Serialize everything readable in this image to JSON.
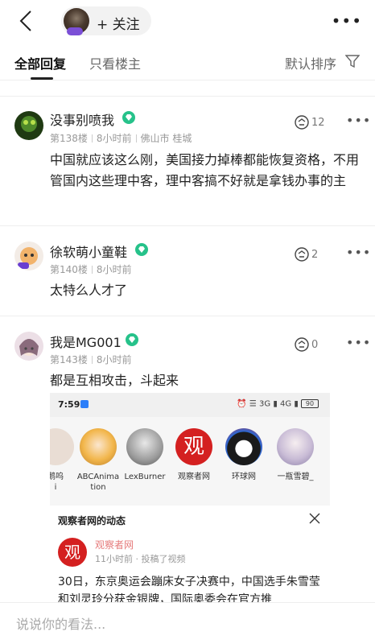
{
  "header": {
    "follow_label": "+ 关注"
  },
  "tabs": {
    "all": "全部回复",
    "host_only": "只看楼主",
    "sort": "默认排序"
  },
  "comments": [
    {
      "name": "没事别喷我",
      "floor": "第138楼",
      "time": "8小时前",
      "location": "佛山市 桂城",
      "likes": "12",
      "text": "中国就应该这么刚，美国接力掉棒都能恢复资格，不用管国内这些理中客，理中客搞不好就是拿钱办事的主"
    },
    {
      "name": "徐软萌小童鞋",
      "floor": "第140楼",
      "time": "8小时前",
      "likes": "2",
      "text": "太特么人才了"
    },
    {
      "name": "我是MG001",
      "floor": "第143楼",
      "time": "8小时前",
      "likes": "0",
      "text": "都是互相攻击，斗起来"
    }
  ],
  "embed": {
    "status_time": "7:59",
    "battery": "90",
    "stories": [
      "鹅呜\ni",
      "ABCAnima\ntion",
      "LexBurner",
      "观察者网",
      "环球网",
      "一瓶雪碧_"
    ],
    "card_title": "观察者网的动态",
    "source_name": "观察者网",
    "source_meta": "11小时前 · 投稿了视频",
    "body": "30日，东京奥运会蹦床女子决赛中，中国选手朱雪莹和刘灵玲分获金银牌，国际奥委会在官方推"
  },
  "input": {
    "placeholder": "说说你的看法..."
  },
  "colors": {
    "vip_green": "#26c28a",
    "brand_red": "#d42020"
  }
}
